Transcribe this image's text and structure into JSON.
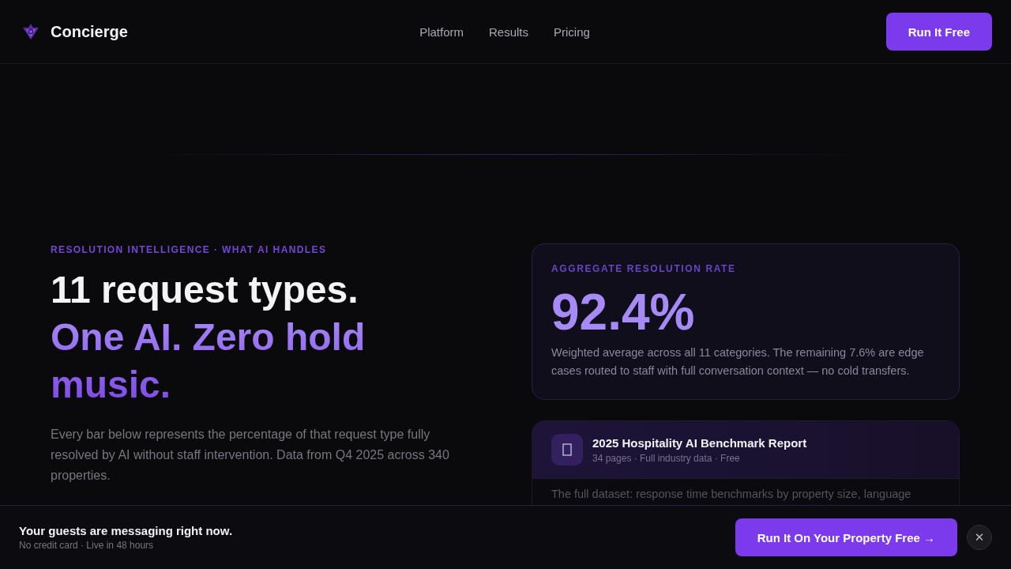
{
  "nav": {
    "brand": "Concierge",
    "links": [
      "Platform",
      "Results",
      "Pricing"
    ],
    "cta": "Run It Free"
  },
  "hero": {
    "eyebrow": "RESOLUTION INTELLIGENCE · WHAT AI HANDLES",
    "headline": "11 request types.",
    "headline_accent": "One AI. Zero hold music.",
    "intro": "Every bar below represents the percentage of that request type fully resolved by AI without staff intervention. Data from Q4 2025 across 340 properties."
  },
  "stat_card": {
    "label": "AGGREGATE RESOLUTION RATE",
    "value": "92.4%",
    "description": "Weighted average across all 11 categories. The remaining 7.6% are edge cases routed to staff with full conversation context — no cold transfers."
  },
  "report_card": {
    "title": "2025 Hospitality AI Benchmark Report",
    "meta": "34 pages · Full industry data · Free",
    "body": "The full dataset: response time benchmarks by property size, language"
  },
  "sticky_bar": {
    "title": "Your guests are messaging right now.",
    "subtitle": "No credit card · Live in 48 hours",
    "cta": "Run It On Your Property Free →",
    "close": "✕"
  }
}
